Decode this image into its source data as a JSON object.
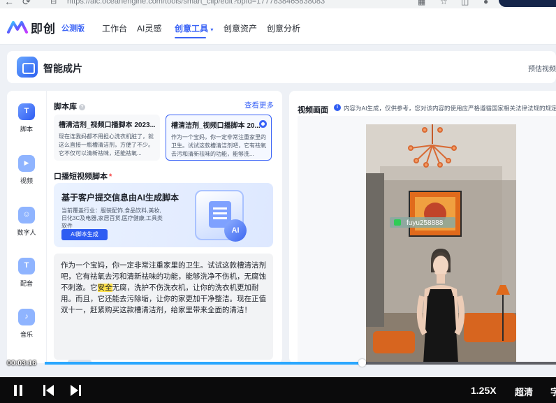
{
  "browser": {
    "url": "https://aic.oceanengine.com/tools/smart_clip/edit?bpId=1777838465838083"
  },
  "header": {
    "logo_text": "即创",
    "edition": "公测版",
    "nav": [
      "工作台",
      "AI灵感",
      "创意工具",
      "创意资产",
      "创意分析"
    ],
    "active_nav_index": 2
  },
  "page": {
    "title": "智能成片",
    "right_text": "预估视频"
  },
  "rail": {
    "items": [
      {
        "label": "脚本",
        "glyph": "T"
      },
      {
        "label": "视频",
        "glyph": "▶"
      },
      {
        "label": "数字人",
        "glyph": "☺"
      },
      {
        "label": "配音",
        "glyph": "T"
      },
      {
        "label": "音乐",
        "glyph": "♪"
      }
    ]
  },
  "script_library": {
    "title": "脚本库",
    "more": "查看更多",
    "templates": [
      {
        "title": "槽清洁剂_视频口播脚本 2023...",
        "desc": "现在连我妈都不用担心洗衣机脏了，就这么直接一瓶槽清洁剂，方便了不少。它不仅可以清新祛味，还能祛氧..."
      },
      {
        "title": "槽清洁剂_视频口播脚本 20...",
        "desc": "作为一个宝妈，你一定非常注重家里的卫生。试试这款槽清洁剂吧，它有祛氧去污和清新祛味的功能，能够洗..."
      }
    ]
  },
  "generator": {
    "section_label": "口播短视频脚本",
    "required_mark": "*",
    "title": "基于客户提交信息由AI生成脚本",
    "desc": "当前覆盖行业：服装配饰,食品饮料,美妆,日化3C及电器,家居百货,医疗健康,工具类软件",
    "button": "AI脚本生成",
    "badge": "AI"
  },
  "script": {
    "before": "作为一个宝妈，你一定非常注重家里的卫生。试试这款槽清洁剂吧，它有祛氧去污和清新祛味的功能，能够洗净不伤机，无腐蚀不刺激。它",
    "highlight": "安全",
    "after": "无腐，洗护不伤洗衣机，让你的洗衣机更加耐用。而且，它还能去污除垢，让你的家更加干净整洁。现在正值双十一，赶紧购买这款槽清洁剂，给家里带来全面的清洁！"
  },
  "preview": {
    "title": "视频画面",
    "note": "内容为AI生成，仅供参考，您对该内容的使用应严格遵循国家相关法律法规的规定。",
    "watermark_id": "fuyu258888"
  },
  "player": {
    "time": "00:03:16",
    "progress": 0.62,
    "speed": "1.25X",
    "quality": "超清",
    "subtitle": "字"
  }
}
